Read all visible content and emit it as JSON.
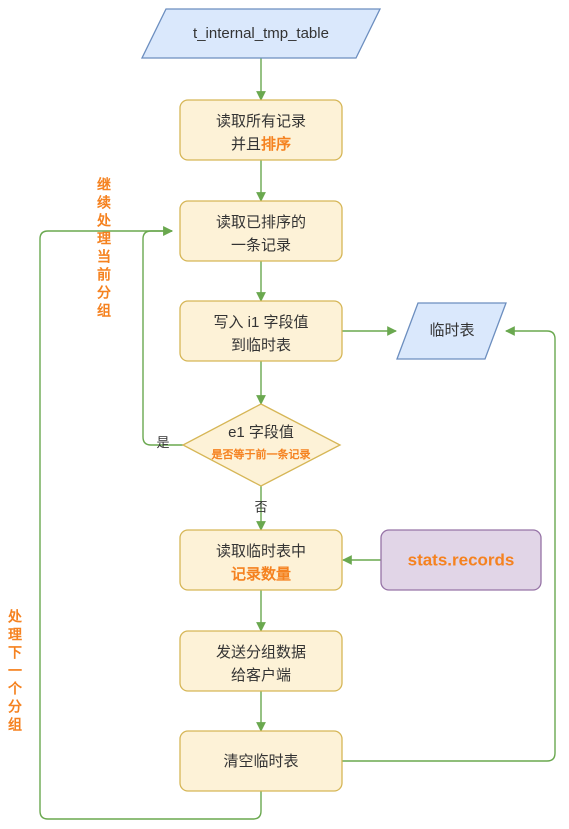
{
  "diagram": {
    "title": "MySQL temporary table group-by flow",
    "colors": {
      "accent": "#f58220",
      "edge": "#6aa84f",
      "process_fill": "#fdf2d7",
      "process_stroke": "#d6b656",
      "io_fill": "#dae8fc",
      "io_stroke": "#6c8ebf",
      "data_fill": "#e1d5e7",
      "data_stroke": "#9673a6",
      "text": "#333333"
    }
  },
  "nodes": {
    "source_table": {
      "shape": "parallelogram",
      "label": "t_internal_tmp_table"
    },
    "read_all_sort": {
      "shape": "process",
      "line1": "读取所有记录",
      "line2_plain": "并且",
      "line2_accent": "排序"
    },
    "read_one": {
      "shape": "process",
      "line1": "读取已排序的",
      "line2": "一条记录"
    },
    "write_i1": {
      "shape": "process",
      "line1": "写入 i1 字段值",
      "line2": "到临时表"
    },
    "tmp_table": {
      "shape": "parallelogram",
      "label": "临时表"
    },
    "decision_e1": {
      "shape": "diamond",
      "line1": "e1 字段值",
      "line2": "是否等于前一条记录"
    },
    "read_count": {
      "shape": "process",
      "line1": "读取临时表中",
      "line2_accent": "记录数量"
    },
    "stats_records": {
      "shape": "data",
      "label": "stats.records"
    },
    "send_group": {
      "shape": "process",
      "line1": "发送分组数据",
      "line2": "给客户端"
    },
    "clear_tmp": {
      "shape": "process",
      "label": "清空临时表"
    }
  },
  "edge_labels": {
    "yes": "是",
    "no": "否"
  },
  "annotations": {
    "continue_current_group": "继续处理当前分组",
    "next_group": "处理下一个分组"
  }
}
